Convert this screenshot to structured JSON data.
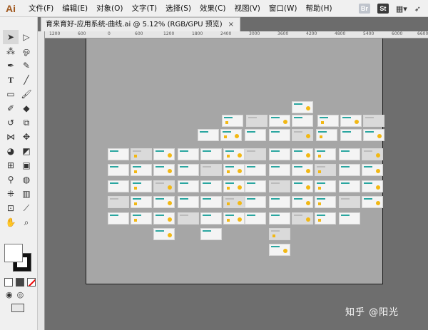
{
  "app": {
    "logo": "Ai"
  },
  "menu": [
    {
      "label": "文件(F)"
    },
    {
      "label": "编辑(E)"
    },
    {
      "label": "对象(O)"
    },
    {
      "label": "文字(T)"
    },
    {
      "label": "选择(S)"
    },
    {
      "label": "效果(C)"
    },
    {
      "label": "视图(V)"
    },
    {
      "label": "窗口(W)"
    },
    {
      "label": "帮助(H)"
    }
  ],
  "menu_right": {
    "bridge": "Br",
    "stock": "St"
  },
  "document": {
    "tab_title": "育来育好-应用系统-曲线.ai @ 5.12% (RGB/GPU 预览)",
    "close": "×"
  },
  "ruler": {
    "ticks": [
      "1200",
      "600",
      "0",
      "600",
      "1200",
      "1800",
      "2400",
      "3000",
      "3600",
      "4200",
      "4800",
      "5400",
      "6000",
      "6600"
    ]
  },
  "icons": {
    "selection": "selection-tool-icon",
    "direct": "direct-selection-icon",
    "magic": "magic-wand-icon",
    "lasso": "lasso-icon",
    "pen": "pen-icon",
    "curvature": "curvature-icon",
    "type": "type-icon",
    "line": "line-segment-icon",
    "rect": "rectangle-icon",
    "brush": "paintbrush-icon",
    "shaper": "shaper-icon",
    "eraser": "eraser-icon",
    "rotate": "rotate-icon",
    "scale": "scale-icon",
    "warp": "width-tool-icon",
    "free": "free-transform-icon",
    "shape-builder": "shape-builder-icon",
    "perspective": "perspective-icon",
    "mesh": "mesh-icon",
    "gradient": "gradient-icon",
    "eyedropper": "eyedropper-icon",
    "blend": "blend-icon",
    "symbol": "symbol-sprayer-icon",
    "graph": "column-graph-icon",
    "artboard": "artboard-icon",
    "slice": "slice-icon",
    "hand": "hand-icon",
    "zoom": "zoom-icon"
  },
  "accent_colors": {
    "teal": "#2aa6a0",
    "yellow": "#f2b814",
    "artboard": "#a6a6a6",
    "pasteboard": "#6e6e6e"
  },
  "watermark": "知乎 @阳光"
}
